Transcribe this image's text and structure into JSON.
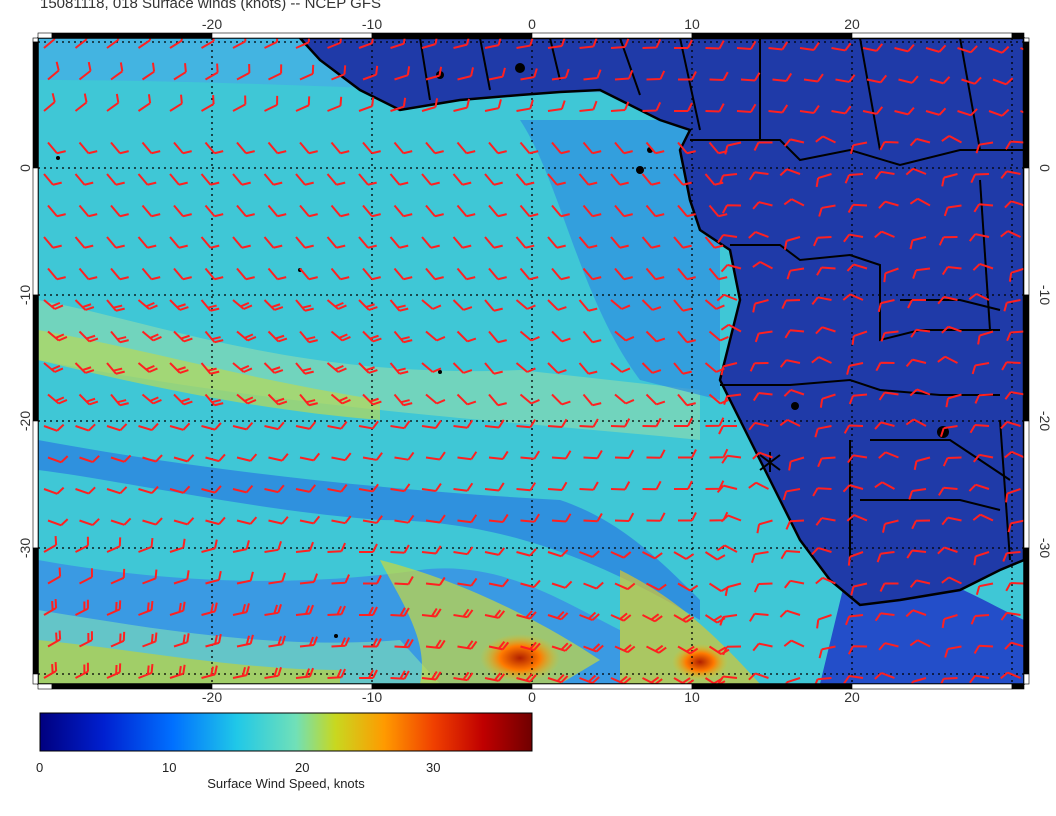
{
  "title": "15081118, 018 Surface winds (knots) -- NCEP GFS",
  "map": {
    "lon_ticks": [
      "-20",
      "-10",
      "0",
      "10",
      "20"
    ],
    "lat_ticks": [
      "0",
      "-10",
      "-20",
      "-30"
    ],
    "lon_range": [
      -31,
      31
    ],
    "lat_range": [
      -40,
      10
    ],
    "gridlines": "dotted every 10 degrees",
    "land_color": "#1f3aa8",
    "barb_color": "#ff2020",
    "coastline_color": "#000000"
  },
  "colorbar": {
    "label": "Surface Wind Speed, knots",
    "ticks": [
      "0",
      "10",
      "20",
      "30"
    ],
    "range": [
      0,
      38
    ],
    "colors": [
      "#00007f",
      "#0030ff",
      "#00b0ff",
      "#40e0d0",
      "#c8d820",
      "#ff9000",
      "#d00000",
      "#7f0000"
    ]
  }
}
